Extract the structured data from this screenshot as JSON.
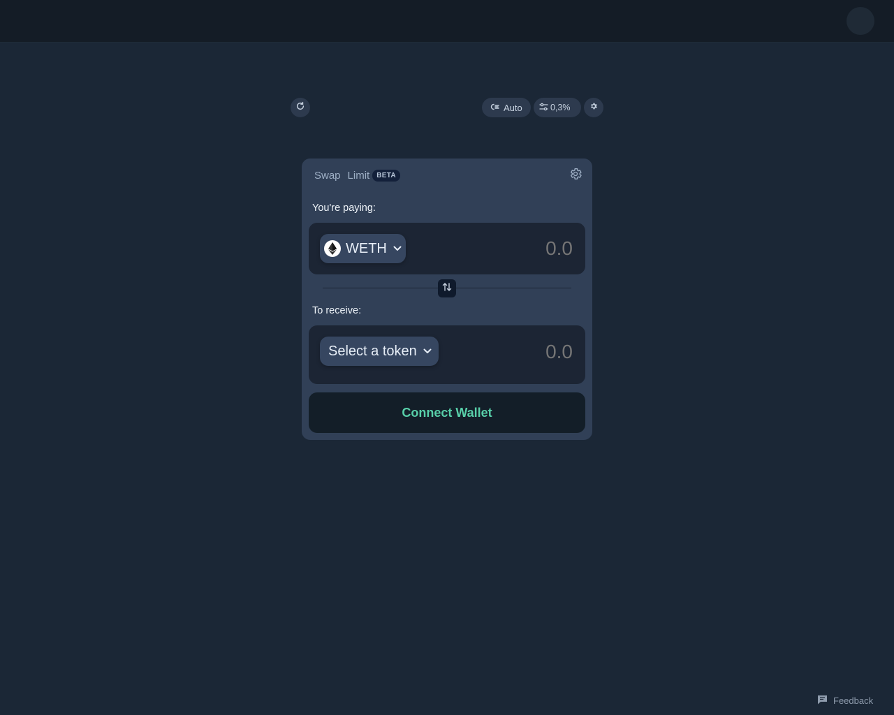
{
  "header": {},
  "toolbar": {
    "auto_label": "Auto",
    "slippage_label": "0,3%"
  },
  "swap_card": {
    "tabs": [
      {
        "label": "Swap"
      },
      {
        "label": "Limit",
        "badge": "BETA"
      }
    ],
    "paying": {
      "label": "You're paying:",
      "token": "WETH",
      "amount_placeholder": "0.0"
    },
    "receive": {
      "label": "To receive:",
      "token_placeholder": "Select a token",
      "amount_placeholder": "0.0"
    },
    "connect_label": "Connect Wallet"
  },
  "footer": {
    "feedback_label": "Feedback"
  },
  "icons": {
    "refresh": "refresh-icon",
    "auto": "gas-route-icon",
    "slippage": "sliders-icon",
    "settings": "gear-icon",
    "token": "ethereum-icon",
    "chevron": "chevron-down-icon",
    "switch": "swap-arrows-icon",
    "feedback": "chat-bubble-icon"
  },
  "colors": {
    "background": "#1b2736",
    "card": "#314057",
    "panel": "#1c2534",
    "accent": "#58cfa9"
  }
}
